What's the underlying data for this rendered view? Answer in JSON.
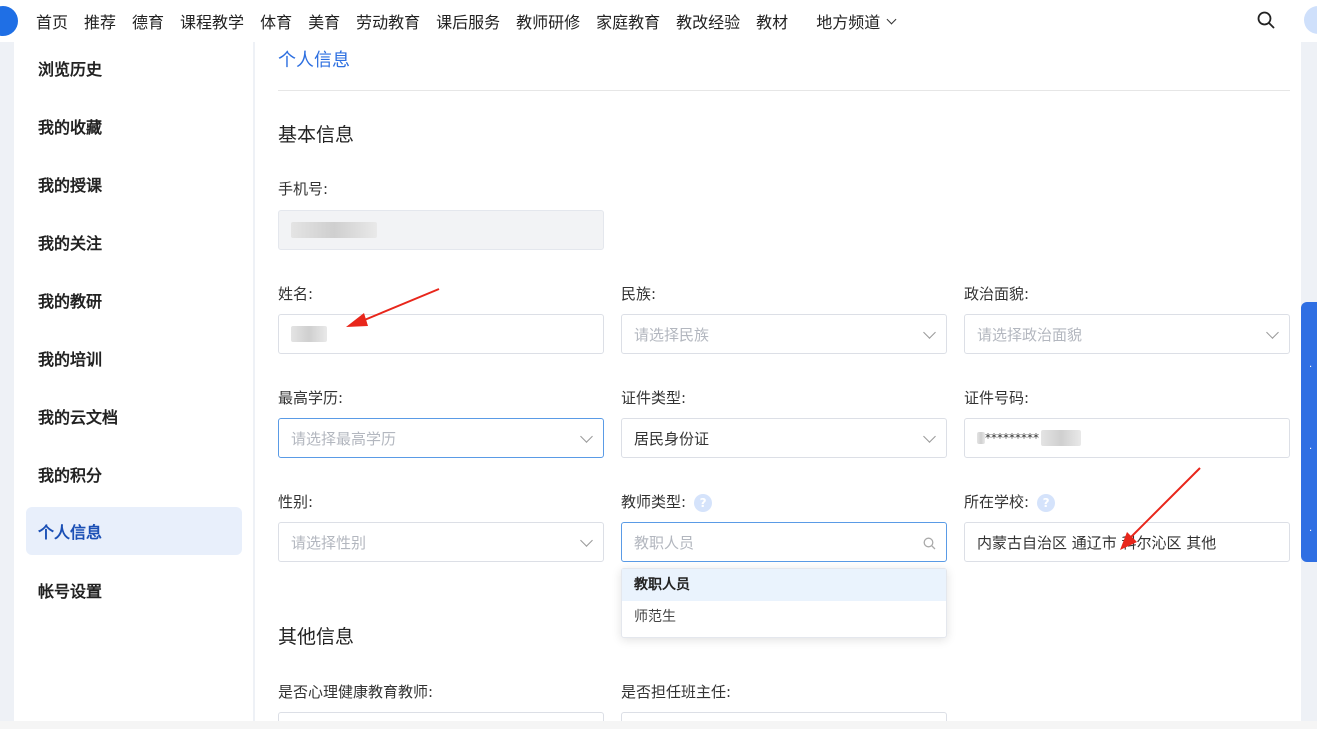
{
  "nav": {
    "items": [
      "首页",
      "推荐",
      "德育",
      "课程教学",
      "体育",
      "美育",
      "劳动教育",
      "课后服务",
      "教师研修",
      "家庭教育",
      "教改经验",
      "教材"
    ],
    "more": "地方频道"
  },
  "sidebar": {
    "items": [
      "浏览历史",
      "我的收藏",
      "我的授课",
      "我的关注",
      "我的教研",
      "我的培训",
      "我的云文档",
      "我的积分",
      "个人信息",
      "帐号设置"
    ],
    "active": "个人信息"
  },
  "main": {
    "tab": "个人信息",
    "basic_title": "基本信息",
    "other_title": "其他信息",
    "phone_label": "手机号:",
    "name_label": "姓名:",
    "ethnic_label": "民族:",
    "ethnic_placeholder": "请选择民族",
    "political_label": "政治面貌:",
    "political_placeholder": "请选择政治面貌",
    "edu_label": "最高学历:",
    "edu_placeholder": "请选择最高学历",
    "idtype_label": "证件类型:",
    "idtype_value": "居民身份证",
    "idnum_label": "证件号码:",
    "idnum_value": "*********",
    "gender_label": "性别:",
    "gender_placeholder": "请选择性别",
    "teachertype_label": "教师类型:",
    "teachertype_placeholder": "教职人员",
    "school_label": "所在学校:",
    "school_value": "内蒙古自治区 通辽市 科尔沁区 其他",
    "help_glyph": "?",
    "dropdown_options": [
      "教职人员",
      "师范生"
    ],
    "psych_label": "是否心理健康教育教师:",
    "headteacher_label": "是否担任班主任:"
  },
  "colors": {
    "accent": "#2d6fe0",
    "annotation": "#e8261b"
  }
}
